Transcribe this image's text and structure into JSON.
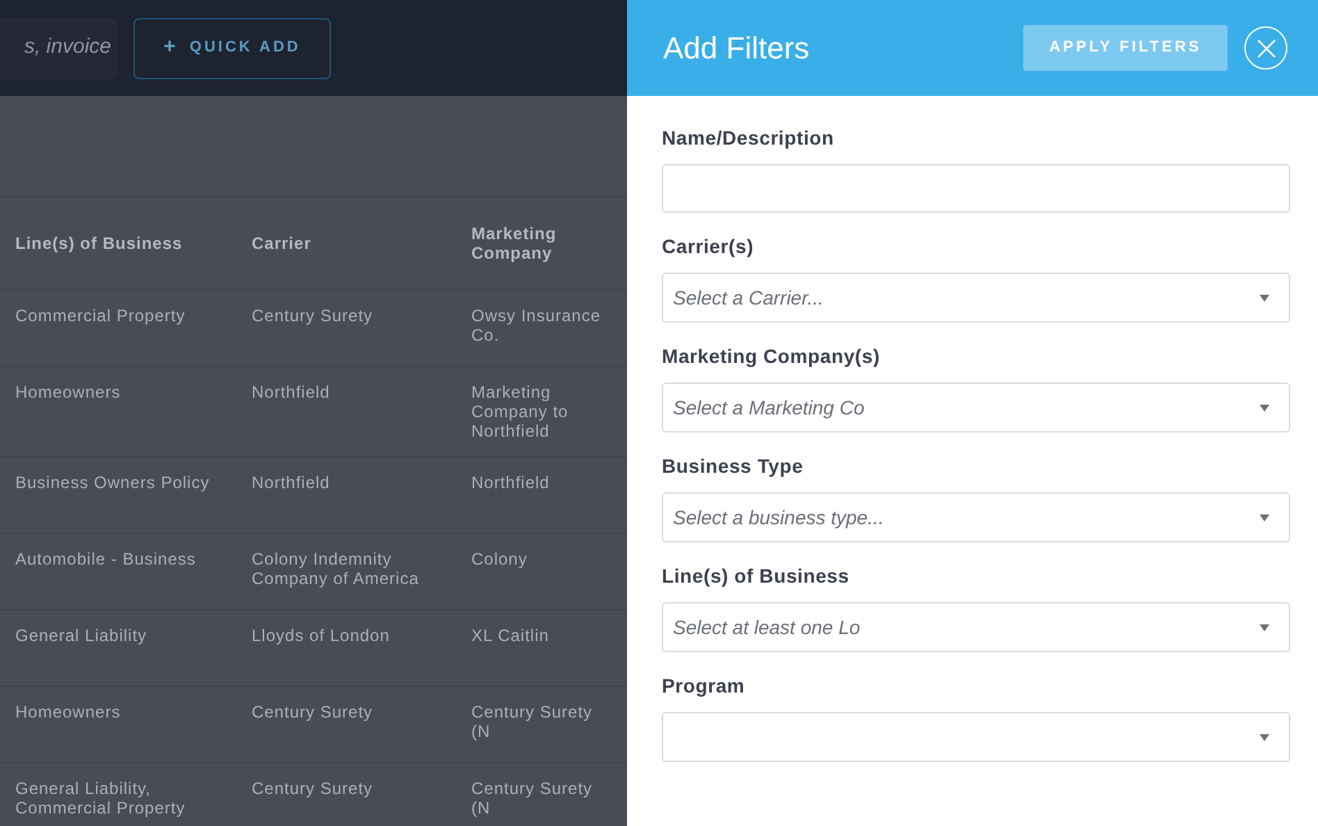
{
  "top_bar": {
    "search": {
      "placeholder": "s, invoice"
    },
    "quick_add": {
      "icon": "+",
      "label": "QUICK ADD"
    }
  },
  "table": {
    "columns": [
      "Line(s) of Business",
      "Carrier",
      "Marketing Company"
    ],
    "rows": [
      [
        "Commercial Property",
        "Century Surety",
        "Owsy Insurance Co."
      ],
      [
        "Homeowners",
        "Northfield",
        "Marketing Company to Northfield"
      ],
      [
        "Business Owners Policy",
        "Northfield",
        "Northfield"
      ],
      [
        "Automobile - Business",
        "Colony Indemnity Company of America",
        "Colony"
      ],
      [
        "General Liability",
        "Lloyds of London",
        "XL Caitlin"
      ],
      [
        "Homeowners",
        "Century Surety",
        "Century Surety (N"
      ],
      [
        "General Liability, Commercial Property",
        "Century Surety",
        "Century Surety (N"
      ]
    ]
  },
  "panel": {
    "title": "Add Filters",
    "apply_button": "APPLY FILTERS",
    "fields": [
      {
        "kind": "text",
        "label": "Name/Description"
      },
      {
        "kind": "select",
        "label": "Carrier(s)",
        "placeholder": "Select a Carrier..."
      },
      {
        "kind": "select",
        "label": "Marketing Company(s)",
        "placeholder": "Select a Marketing Co"
      },
      {
        "kind": "select",
        "label": "Business Type",
        "placeholder": "Select a business type..."
      },
      {
        "kind": "select",
        "label": "Line(s) of Business",
        "placeholder": "Select at least one Lo"
      },
      {
        "kind": "select",
        "label": "Program"
      }
    ]
  }
}
